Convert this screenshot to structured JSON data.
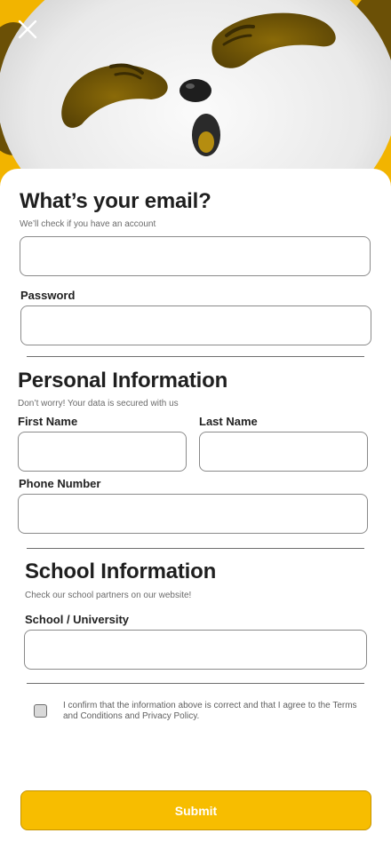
{
  "hero": {
    "close_icon": "close-icon",
    "accent_color": "#f7bd00"
  },
  "account": {
    "title": "What’s your email?",
    "subtitle": "We’ll check if you have an account",
    "email_value": "",
    "password_label": "Password",
    "password_value": ""
  },
  "personal": {
    "title": "Personal Information",
    "subtitle": "Don’t worry! Your data is secured with us",
    "first_name_label": "First Name",
    "first_name_value": "",
    "last_name_label": "Last Name",
    "last_name_value": "",
    "phone_label": "Phone Number",
    "phone_value": ""
  },
  "school": {
    "title": "School Information",
    "subtitle": "Check our school partners on our website!",
    "school_label": "School / University",
    "school_value": ""
  },
  "consent": {
    "checked": false,
    "text": "I confirm that the information above is correct and that I agree to the Terms and Conditions and Privacy Policy."
  },
  "submit_label": "Submit"
}
